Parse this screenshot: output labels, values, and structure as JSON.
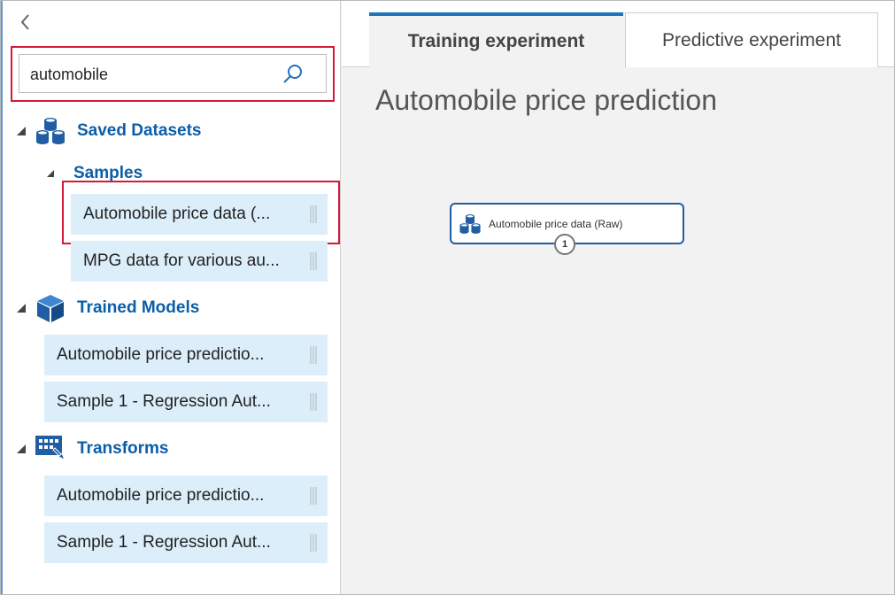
{
  "search": {
    "value": "automobile"
  },
  "sidebar": {
    "saved_datasets": {
      "label": "Saved Datasets",
      "samples_label": "Samples",
      "items": [
        "Automobile price data (...",
        "MPG data for various au..."
      ]
    },
    "trained_models": {
      "label": "Trained Models",
      "items": [
        "Automobile price predictio...",
        "Sample 1 - Regression Aut..."
      ]
    },
    "transforms": {
      "label": "Transforms",
      "items": [
        "Automobile price predictio...",
        "Sample 1 - Regression Aut..."
      ]
    }
  },
  "tabs": {
    "training": "Training experiment",
    "predictive": "Predictive experiment"
  },
  "canvas": {
    "title": "Automobile price prediction",
    "module_label": "Automobile price data (Raw)",
    "port_label": "1"
  },
  "colors": {
    "accent": "#1e73be",
    "highlight": "#d21a3a",
    "item_bg": "#dceef9",
    "link": "#0b5ea8"
  }
}
